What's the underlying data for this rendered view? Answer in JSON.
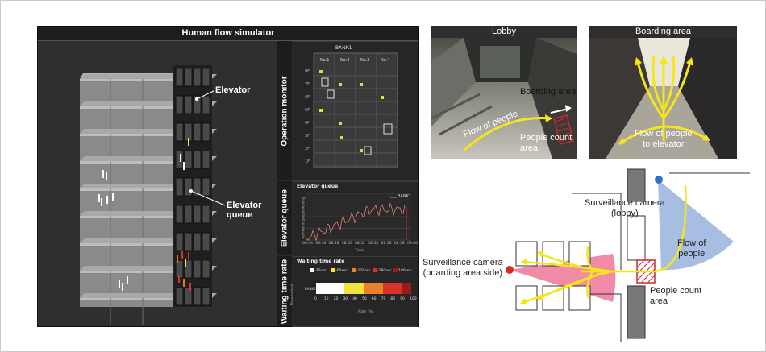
{
  "simulator": {
    "title": "Human flow simulator",
    "building_labels": {
      "elevator": "Elevator",
      "elevator_queue": "Elevator queue"
    },
    "operation_monitor": {
      "label": "Operation monitor",
      "bank": "BANK1",
      "cars": [
        "No.1",
        "No.2",
        "No.3",
        "No.4"
      ],
      "floors": [
        "8F",
        "7F",
        "6F",
        "5F",
        "4F",
        "3F",
        "2F",
        "1F"
      ]
    },
    "elevator_queue": {
      "label": "Elevator queue",
      "chart_title": "Elevator queue",
      "legend": "BANK1",
      "ylabel": "Number of people waiting",
      "xlabel": "Time",
      "xticks": [
        "08:44",
        "08:46",
        "08:48",
        "08:50",
        "08:52",
        "08:54",
        "08:56",
        "08:58",
        "09:00"
      ]
    },
    "waiting_time_rate": {
      "label": "Waiting time rate",
      "chart_title": "Waiting time rate",
      "legend": [
        {
          "label": "-30sec",
          "color": "#ffffff"
        },
        {
          "label": "-60sec",
          "color": "#f2e33a"
        },
        {
          "label": "-120sec",
          "color": "#e8822a"
        },
        {
          "label": "-180sec",
          "color": "#d9322a"
        },
        {
          "label": "180sec-",
          "color": "#9b1a1a"
        }
      ],
      "ylabel": "Elevator bank",
      "row_label": "BANK1",
      "xticks": [
        "0",
        "10",
        "20",
        "30",
        "40",
        "50",
        "60",
        "70",
        "80",
        "90",
        "100"
      ],
      "xlabel": "Rate [%]",
      "segments": [
        {
          "percent": 30,
          "color": "#ffffff"
        },
        {
          "percent": 20,
          "color": "#f2e33a"
        },
        {
          "percent": 20,
          "color": "#e8822a"
        },
        {
          "percent": 20,
          "color": "#d9322a"
        },
        {
          "percent": 10,
          "color": "#9b1a1a"
        }
      ]
    }
  },
  "lobby_photo": {
    "title": "Lobby",
    "boarding_area": "Boarding area",
    "flow": "Flow of people",
    "count_area": "People count\narea"
  },
  "boarding_photo": {
    "title": "Boarding area",
    "flow": "Flow of people\nto elevator"
  },
  "diagram": {
    "camera_lobby": "Surveillance camera\n(lobby)",
    "camera_boarding": "Surveillance camera\n(boarding area side)",
    "flow": "Flow of\npeople",
    "count_area": "People count\narea"
  },
  "colors": {
    "flow_arrow": "#f5e51b",
    "count_area": "#c8282e",
    "camera_lobby": "#2f6fd0",
    "camera_boarding": "#d92b2b",
    "fov_lobby": "#9db7df",
    "fov_boarding": "#ef7d9c"
  }
}
